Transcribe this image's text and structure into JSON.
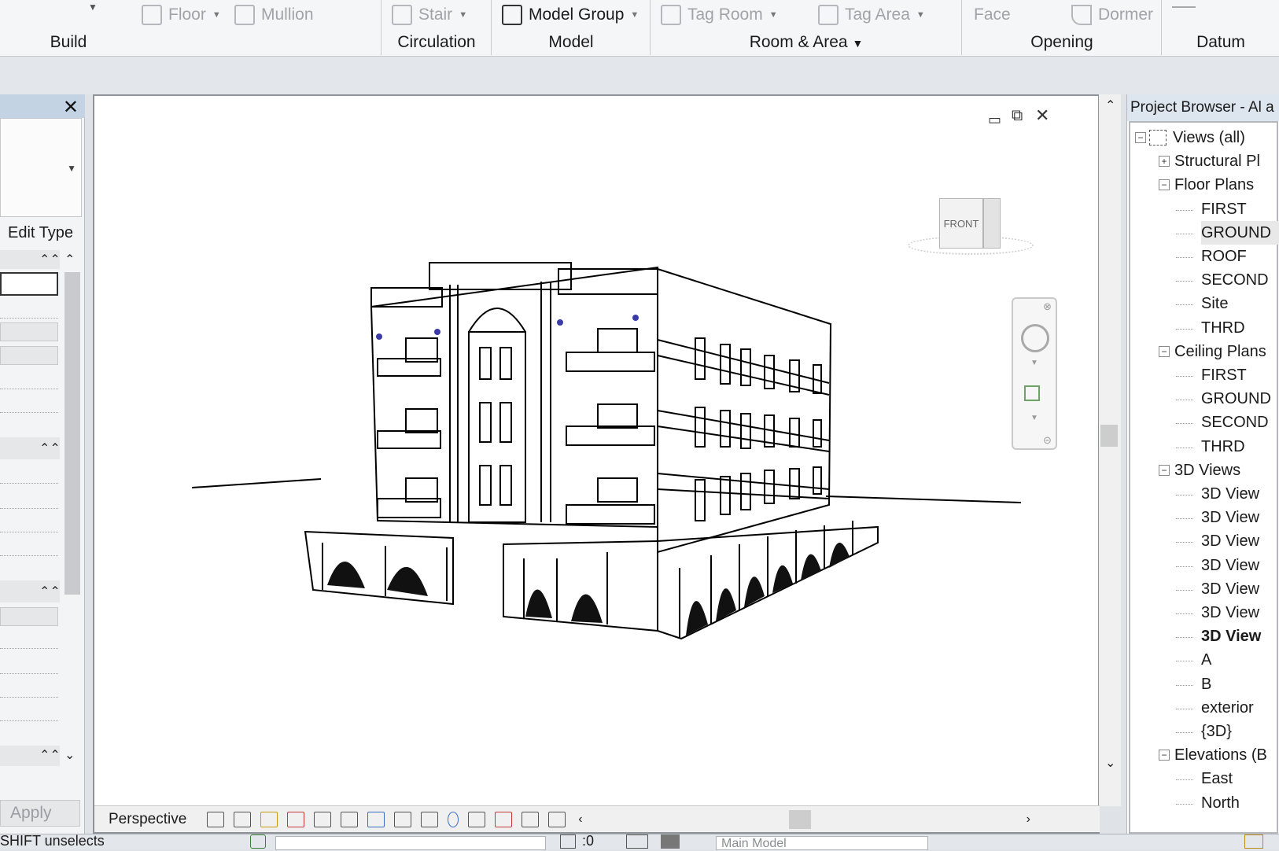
{
  "ribbon": {
    "tools": [
      {
        "label": "Floor",
        "icon": "floor-icon"
      },
      {
        "label": "Mullion",
        "icon": "mullion-icon"
      },
      {
        "label": "Stair",
        "icon": "stair-icon"
      },
      {
        "label": "Model Group",
        "icon": "model-group-icon"
      },
      {
        "label": "Tag Room",
        "icon": "tag-room-icon"
      },
      {
        "label": "Tag Area",
        "icon": "tag-area-icon"
      },
      {
        "label": "Face",
        "icon": "face-icon"
      },
      {
        "label": "Dormer",
        "icon": "dormer-icon"
      }
    ],
    "panels": [
      "Build",
      "Circulation",
      "Model",
      "Room & Area",
      "Opening",
      "Datum"
    ]
  },
  "properties": {
    "edit_type": "Edit Type",
    "apply": "Apply"
  },
  "viewport": {
    "viewcube_label": "FRONT",
    "view_style": "Perspective"
  },
  "browser": {
    "title": "Project Browser - Al a",
    "tree": [
      {
        "label": "Views (all)",
        "level": 0,
        "toggle": "−"
      },
      {
        "label": "Structural Pl",
        "level": 1,
        "toggle": "+"
      },
      {
        "label": "Floor Plans",
        "level": 1,
        "toggle": "−"
      },
      {
        "label": "FIRST",
        "level": 2
      },
      {
        "label": "GROUND",
        "level": 2,
        "selected": true
      },
      {
        "label": "ROOF",
        "level": 2
      },
      {
        "label": "SECOND",
        "level": 2
      },
      {
        "label": "Site",
        "level": 2
      },
      {
        "label": "THRD",
        "level": 2
      },
      {
        "label": "Ceiling Plans",
        "level": 1,
        "toggle": "−"
      },
      {
        "label": "FIRST",
        "level": 2
      },
      {
        "label": "GROUND",
        "level": 2
      },
      {
        "label": "SECOND",
        "level": 2
      },
      {
        "label": "THRD",
        "level": 2
      },
      {
        "label": "3D Views",
        "level": 1,
        "toggle": "−"
      },
      {
        "label": "3D View",
        "level": 2
      },
      {
        "label": "3D View",
        "level": 2
      },
      {
        "label": "3D View",
        "level": 2
      },
      {
        "label": "3D View",
        "level": 2
      },
      {
        "label": "3D View",
        "level": 2
      },
      {
        "label": "3D View",
        "level": 2
      },
      {
        "label": "3D View",
        "level": 2,
        "bold": true
      },
      {
        "label": "A",
        "level": 2
      },
      {
        "label": "B",
        "level": 2
      },
      {
        "label": "exterior",
        "level": 2
      },
      {
        "label": "{3D}",
        "level": 2
      },
      {
        "label": "Elevations (B",
        "level": 1,
        "toggle": "−"
      },
      {
        "label": "East",
        "level": 2
      },
      {
        "label": "North",
        "level": 2
      }
    ]
  },
  "status": {
    "hint": "SHIFT unselects",
    "count": ":0",
    "model": "Main Model"
  }
}
